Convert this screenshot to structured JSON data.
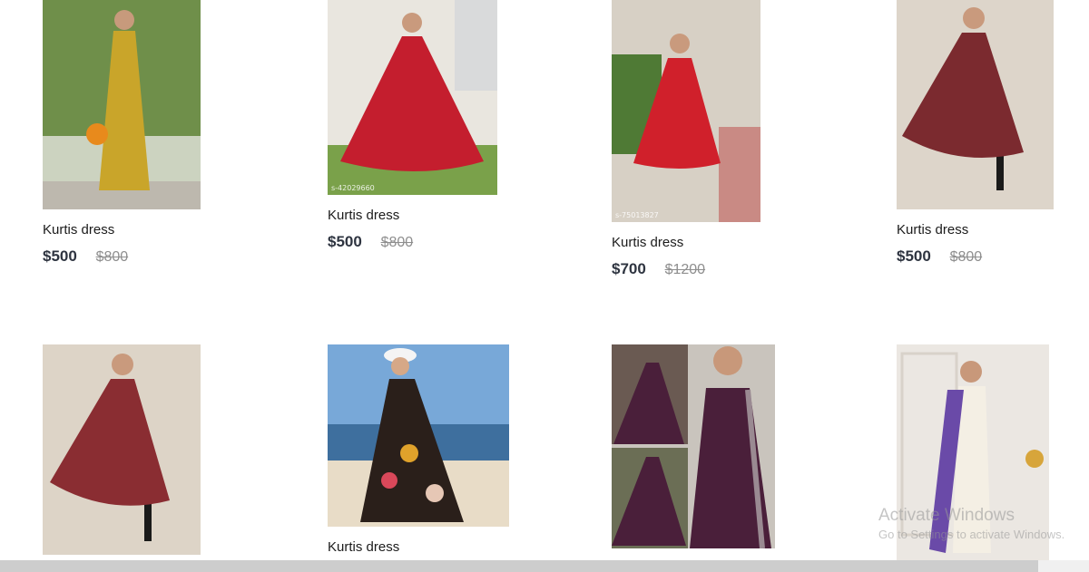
{
  "products": [
    {
      "name": "Kurtis dress",
      "price": "$500",
      "mrp": "$800",
      "sku": "",
      "colors": {
        "bg": "#6f8f4a",
        "dress": "#c9a52a",
        "accent": "#e4e4dd"
      }
    },
    {
      "name": "Kurtis dress",
      "price": "$500",
      "mrp": "$800",
      "sku": "s-42029660",
      "colors": {
        "bg": "#e9e6df",
        "dress": "#c41e2e",
        "accent": "#7aa14a"
      }
    },
    {
      "name": "Kurtis dress",
      "price": "$700",
      "mrp": "$1200",
      "sku": "s-75013827",
      "colors": {
        "bg": "#d7d0c5",
        "dress": "#d0202b",
        "accent": "#4f7a35"
      }
    },
    {
      "name": "Kurtis dress",
      "price": "$500",
      "mrp": "$800",
      "sku": "",
      "colors": {
        "bg": "#ddd5ca",
        "dress": "#7b2a2f",
        "accent": "#1a1a1a"
      }
    },
    {
      "name": "",
      "price": "",
      "mrp": "",
      "sku": "",
      "colors": {
        "bg": "#ddd4c7",
        "dress": "#8a2d32",
        "accent": "#1a1a1a"
      }
    },
    {
      "name": "Kurtis dress",
      "price": "",
      "mrp": "",
      "sku": "",
      "colors": {
        "bg": "#78a8d8",
        "dress": "#2a1f1a",
        "accent": "#e8dcc7"
      }
    },
    {
      "name": "",
      "price": "",
      "mrp": "",
      "sku": "",
      "colors": {
        "bg": "#c9c4bd",
        "dress": "#4a1f3a",
        "accent": "#9a8a92"
      }
    },
    {
      "name": "",
      "price": "",
      "mrp": "",
      "sku": "",
      "colors": {
        "bg": "#ebe7e2",
        "dress": "#f4efe4",
        "accent": "#6a4aa8"
      }
    }
  ],
  "watermark": {
    "title": "Activate Windows",
    "subtitle": "Go to Settings to activate Windows."
  }
}
